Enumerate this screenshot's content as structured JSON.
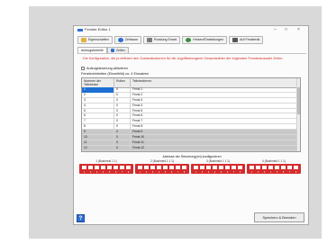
{
  "window": {
    "title": "Fenster-Editor 1",
    "controls": [
      "–",
      "□",
      "×"
    ]
  },
  "toolbar": [
    {
      "label": "Eigenschaften",
      "icon": "folder-icon",
      "color": "#e2b23a"
    },
    {
      "label": "Zeitraum",
      "icon": "clock-icon",
      "color": "#2f6fd1"
    },
    {
      "label": "Rundung Einzel",
      "icon": "tools-icon",
      "color": "#7a7a7a"
    },
    {
      "label": "Heizen/Einstellungen",
      "icon": "gear-icon",
      "color": "#3c8d3c"
    },
    {
      "label": "Auf Fensterdk",
      "icon": "window-icon",
      "color": "#555555"
    }
  ],
  "tabs": [
    {
      "label": "Aufzugstoreelle",
      "active": true
    },
    {
      "label": "Zeilen",
      "active": false
    }
  ],
  "warning": "Die Konfiguration, die ja definiert den Zustandsrahmen für die zugriffsbezogene Gesamtzähler der folgenden Fensterauswahl Zeilen.",
  "checkbox_label": "Aufzugsteuerung aktivieren",
  "size_line": "Fenstereinheiten (Einzelbild) zu: 4 Einsatzen",
  "table": {
    "headers": [
      "Nummer der Teilstrecke",
      "Rollen",
      "Teilstreckennr."
    ],
    "rows": [
      {
        "a": "1",
        "b": "0",
        "c": "Fenst 1",
        "shaded": false,
        "selected": true
      },
      {
        "a": "2",
        "b": "0",
        "c": "Fenst 2",
        "shaded": false,
        "selected": false
      },
      {
        "a": "3",
        "b": "0",
        "c": "Fenst 3",
        "shaded": false,
        "selected": false
      },
      {
        "a": "4",
        "b": "0",
        "c": "Fenst 4",
        "shaded": false,
        "selected": false
      },
      {
        "a": "5",
        "b": "0",
        "c": "Fenst 5",
        "shaded": false,
        "selected": false
      },
      {
        "a": "6",
        "b": "0",
        "c": "Fenst 6",
        "shaded": false,
        "selected": false
      },
      {
        "a": "7",
        "b": "0",
        "c": "Fenst 7",
        "shaded": false,
        "selected": false
      },
      {
        "a": "8",
        "b": "0",
        "c": "Fenst 8",
        "shaded": false,
        "selected": false
      },
      {
        "a": "9",
        "b": "0",
        "c": "Fenst 9",
        "shaded": true,
        "selected": false
      },
      {
        "a": "10",
        "b": "0",
        "c": "Fenst 10",
        "shaded": true,
        "selected": false
      },
      {
        "a": "11",
        "b": "0",
        "c": "Fenst 11",
        "shaded": true,
        "selected": false
      },
      {
        "a": "12",
        "b": "0",
        "c": "Fenst 12",
        "shaded": true,
        "selected": false
      }
    ]
  },
  "dip_title": "Adresse der Steuerung(en) konfigurieren",
  "dip_groups": [
    {
      "label": "1 (Bushneid 1 1)"
    },
    {
      "label": "2 (Bushneid 1 1 1)"
    },
    {
      "label": "3 (Bushneid 1 1 1)"
    },
    {
      "label": "4 (Bushneid 1 1 1)"
    }
  ],
  "dip_numbers": [
    "1",
    "2",
    "3",
    "4",
    "5",
    "6",
    "7",
    "8"
  ],
  "help_label": "?",
  "save_label": "Speichern & Beenden",
  "colors": {
    "accent": "#2f6fd1",
    "warning": "#d42c2c",
    "dip": "#d42c2c"
  }
}
